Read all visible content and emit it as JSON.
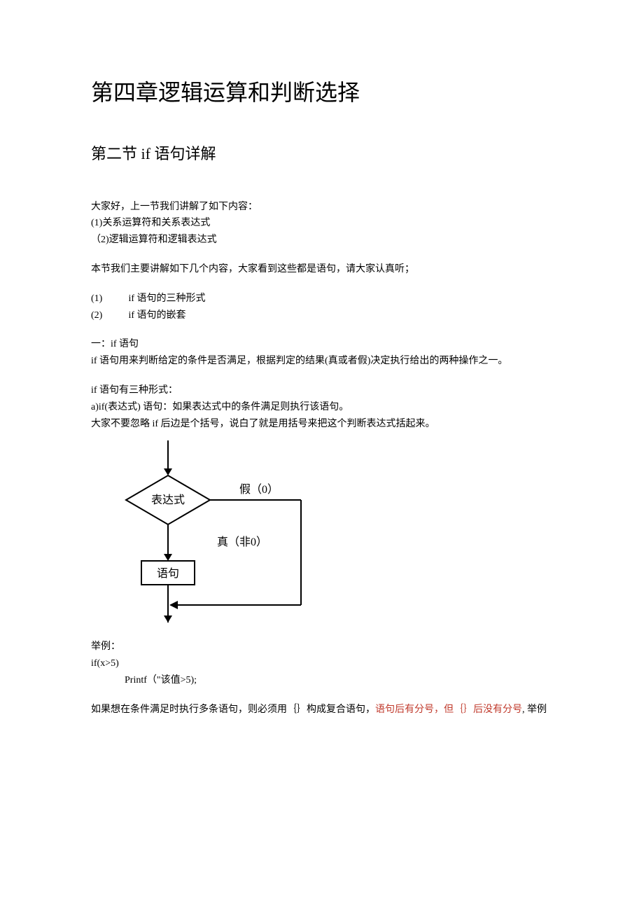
{
  "chapter_title": "第四章逻辑运算和判断选择",
  "section_title": "第二节 if 语句详解",
  "intro_line": "大家好，上一节我们讲解了如下内容：",
  "intro_items": {
    "a": "(1)关系运算符和关系表达式",
    "b": "（2)逻辑运算符和逻辑表达式"
  },
  "this_section_line": "本节我们主要讲解如下几个内容，大家看到这些都是语句，请大家认真听；",
  "toc": {
    "item1_num": "(1)",
    "item1_text": "if 语句的三种形式",
    "item2_num": "(2)",
    "item2_text": "if 语句的嵌套"
  },
  "sec1_heading": "一：if 语句",
  "sec1_p1": "if 语句用来判断给定的条件是否满足，根据判定的结果(真或者假)决定执行给出的两种操作之一。",
  "sec1_p2": "if 语句有三种形式：",
  "sec1_p3": "a)if(表达式) 语句：如果表达式中的条件满足则执行该语句。",
  "sec1_p4": "大家不要忽略 if 后边是个括号，说白了就是用括号来把这个判断表达式括起来。",
  "diagram": {
    "cond": "表达式",
    "false_label": "假（0）",
    "true_label": "真（非0）",
    "stmt": "语句"
  },
  "example_label": "举例：",
  "example_code": {
    "l1": "if(x>5)",
    "l2": "Printf（\"该值>5);"
  },
  "compound_p_a": "如果想在条件满足时执行多条语句，则必须用｛｝构成复合语句，",
  "compound_p_red": "语句后有分号，但｛｝后没有分号",
  "compound_p_b": ", 举例"
}
